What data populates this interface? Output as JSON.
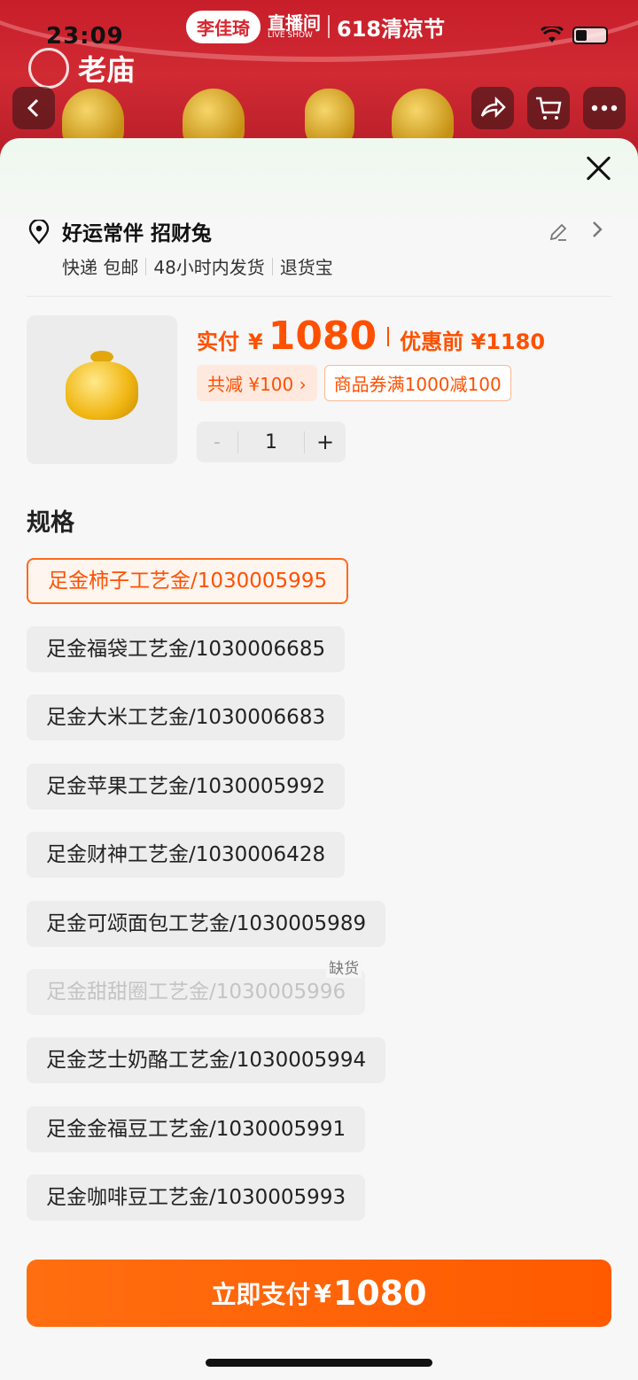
{
  "status_bar": {
    "time": "23:09"
  },
  "hero": {
    "banner_host": "李佳琦",
    "banner_live": "直播间",
    "banner_live_sub": "LIVE SHOW",
    "banner_event": "618清凉节",
    "brand_name": "老庙",
    "bg_color": "#c81e2a"
  },
  "address": {
    "name": "好运常伴 招财兔",
    "delivery": "快递 包邮",
    "ship_time": "48小时内发货",
    "return_service": "退货宝"
  },
  "product": {
    "pay_label": "实付",
    "currency": "¥",
    "price": "1080",
    "original_price_label": "优惠前 ¥1180",
    "discount_chip": "共减 ¥100 ›",
    "coupon_chip": "商品券满1000减100",
    "quantity": "1",
    "accent_color": "#ff5000"
  },
  "spec": {
    "title": "规格",
    "options": [
      {
        "label": "足金柿子工艺金/1030005995",
        "state": "selected"
      },
      {
        "label": "足金福袋工艺金/1030006685",
        "state": "normal"
      },
      {
        "label": "足金大米工艺金/1030006683",
        "state": "normal"
      },
      {
        "label": "足金苹果工艺金/1030005992",
        "state": "normal"
      },
      {
        "label": "足金财神工艺金/1030006428",
        "state": "normal"
      },
      {
        "label": "足金可颂面包工艺金/1030005989",
        "state": "normal"
      },
      {
        "label": "足金甜甜圈工艺金/1030005996",
        "state": "out-of-stock",
        "tag": "缺货"
      },
      {
        "label": "足金芝士奶酪工艺金/1030005994",
        "state": "normal"
      },
      {
        "label": "足金金福豆工艺金/1030005991",
        "state": "normal"
      },
      {
        "label": "足金咖啡豆工艺金/1030005993",
        "state": "normal"
      }
    ]
  },
  "pay_button": {
    "label": "立即支付",
    "currency": "¥",
    "amount": "1080"
  }
}
